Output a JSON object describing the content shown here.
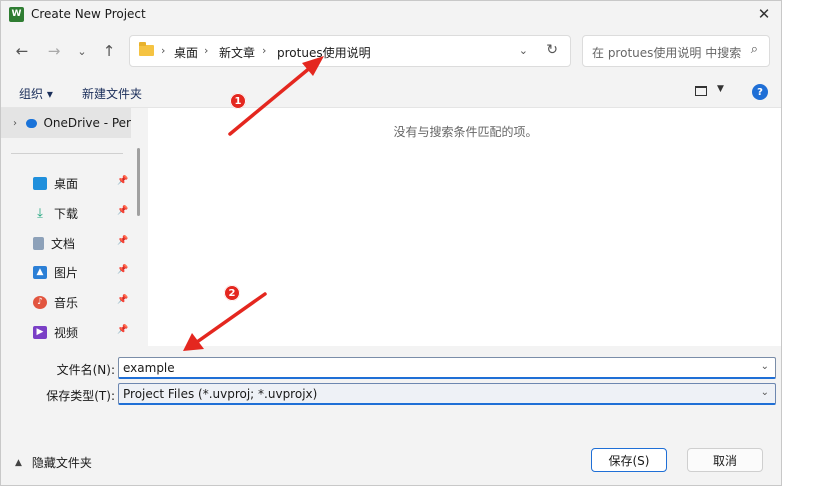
{
  "window": {
    "title": "Create New Project",
    "app_icon_text": "W"
  },
  "toolbar": {
    "back_icon": "←",
    "forward_icon": "→",
    "up_dropdown_icon": "⌄",
    "up_icon": "↑"
  },
  "address": {
    "crumbs": [
      "桌面",
      "新文章",
      "protues使用说明"
    ],
    "separator": "›"
  },
  "search": {
    "placeholder": "在 protues使用说明 中搜索"
  },
  "commands": {
    "organize": "组织 ▾",
    "new_folder": "新建文件夹"
  },
  "nav": {
    "onedrive": "OneDrive - Per",
    "quick_access": [
      {
        "label": "桌面",
        "icon": "desktop-icon",
        "color": "#1f8fdc"
      },
      {
        "label": "下载",
        "icon": "download-icon",
        "color": "#1aa37a"
      },
      {
        "label": "文档",
        "icon": "document-icon",
        "color": "#6b7a8f"
      },
      {
        "label": "图片",
        "icon": "picture-icon",
        "color": "#2b7fd6"
      },
      {
        "label": "音乐",
        "icon": "music-icon",
        "color": "#e2553f"
      },
      {
        "label": "视频",
        "icon": "video-icon",
        "color": "#7a3fc6"
      }
    ]
  },
  "content": {
    "empty_message": "没有与搜索条件匹配的项。"
  },
  "form": {
    "filename_label": "文件名(N):",
    "filename_value": "example",
    "filetype_label": "保存类型(T):",
    "filetype_value": "Project Files (*.uvproj; *.uvprojx)"
  },
  "footer": {
    "hide_folders": "隐藏文件夹",
    "save": "保存(S)",
    "cancel": "取消"
  },
  "annotations": [
    {
      "number": "1",
      "color": "#e4271f"
    },
    {
      "number": "2",
      "color": "#e4271f"
    }
  ],
  "colors": {
    "accent": "#1f6fd6",
    "annotation_red": "#e4271f"
  }
}
